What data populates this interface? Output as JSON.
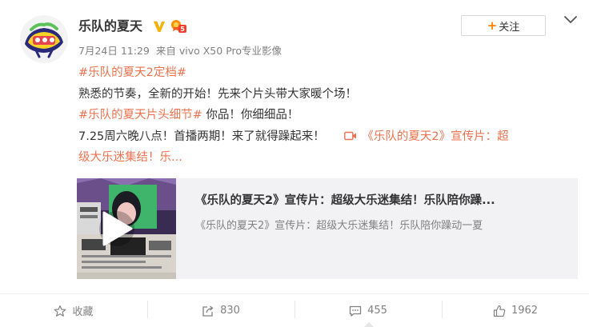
{
  "post": {
    "username": "乐队的夏天",
    "avatar_icon": "band-summer-logo",
    "verified_icon": "verified-v-icon",
    "vip_icon": "vip-level-icon",
    "follow_label": "关注",
    "timestamp": "7月24日 11:29",
    "source_prefix": "来自",
    "source": "vivo X50 Pro专业影像",
    "lines": {
      "hashtag1": "#乐队的夏天2定档#",
      "text1": "熟悉的节奏，全新的开始！先来个片头带大家暖个场！",
      "hashtag2": "#乐队的夏天片头细节#",
      "text2": " 你品！你细细品！",
      "text3": "7.25周六晚八点！首播两期！来了就得躁起来！",
      "video_link": "《乐队的夏天2》宣传片：超",
      "video_link_cont": "级大乐迷集结！乐...",
      "video_link_icon": "video-camera-icon"
    }
  },
  "media_card": {
    "title": "《乐队的夏天2》宣传片：超级大乐迷集结！乐队陪你躁...",
    "description": "《乐队的夏天2》宣传片：超级大乐迷集结！乐队陪你躁动一夏",
    "thumb_icon": "play-icon",
    "background": "#f2f2f5"
  },
  "actions": {
    "favorite_label": "收藏",
    "repost_count": "830",
    "comment_count": "455",
    "like_count": "1962"
  },
  "colors": {
    "accent": "#eb7350",
    "follow_plus": "#ff8200",
    "meta_text": "#808080"
  }
}
